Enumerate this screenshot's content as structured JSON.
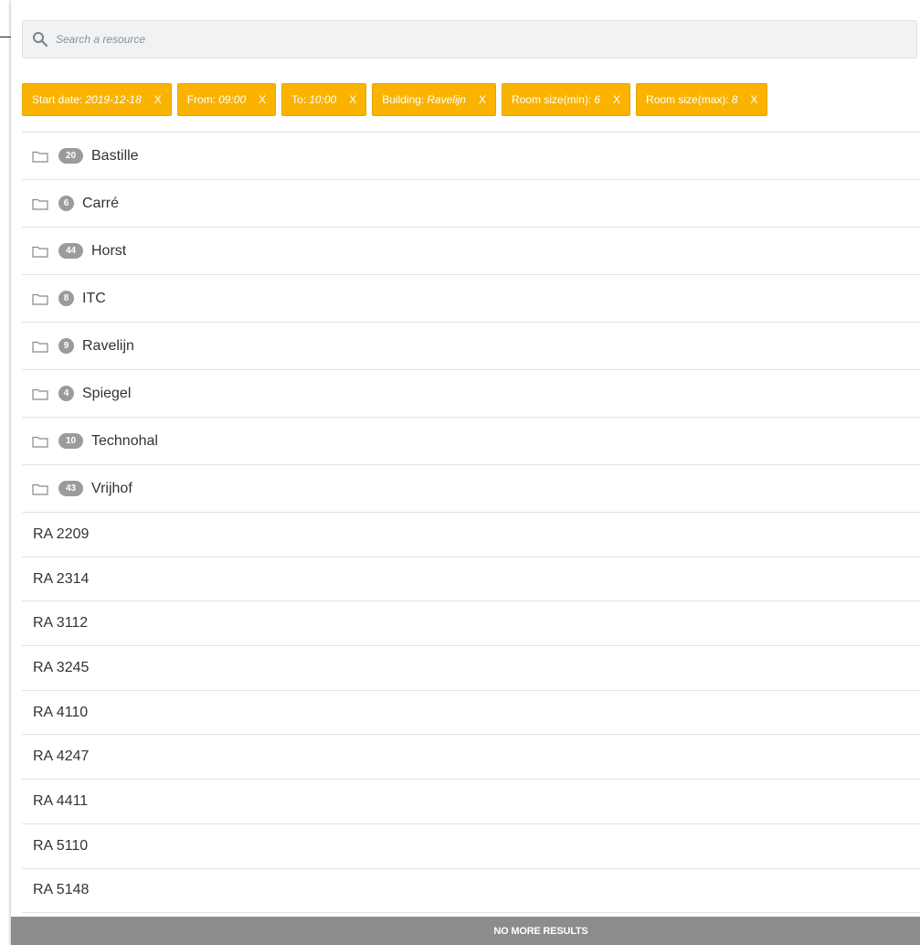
{
  "search": {
    "placeholder": "Search a resource",
    "icon": "search-icon"
  },
  "filters": [
    {
      "label": "Start date:",
      "value": "2019-12-18",
      "remove": "X"
    },
    {
      "label": "From:",
      "value": "09:00",
      "remove": "X"
    },
    {
      "label": "To:",
      "value": "10:00",
      "remove": "X"
    },
    {
      "label": "Building:",
      "value": "Ravelijn",
      "remove": "X"
    },
    {
      "label": "Room size(min):",
      "value": "6",
      "remove": "X"
    },
    {
      "label": "Room size(max):",
      "value": "8",
      "remove": "X"
    }
  ],
  "buildings": [
    {
      "count": "20",
      "name": "Bastille"
    },
    {
      "count": "6",
      "name": "Carré"
    },
    {
      "count": "44",
      "name": "Horst"
    },
    {
      "count": "8",
      "name": "ITC"
    },
    {
      "count": "9",
      "name": "Ravelijn"
    },
    {
      "count": "4",
      "name": "Spiegel"
    },
    {
      "count": "10",
      "name": "Technohal"
    },
    {
      "count": "43",
      "name": "Vrijhof"
    }
  ],
  "rooms": [
    "RA 2209",
    "RA 2314",
    "RA 3112",
    "RA 3245",
    "RA 4110",
    "RA 4247",
    "RA 4411",
    "RA 5110",
    "RA 5148"
  ],
  "footer": {
    "label": "NO MORE RESULTS"
  },
  "colors": {
    "chip": "#f9b300",
    "badge": "#9b9b9b",
    "footer": "#8c8c8c"
  }
}
